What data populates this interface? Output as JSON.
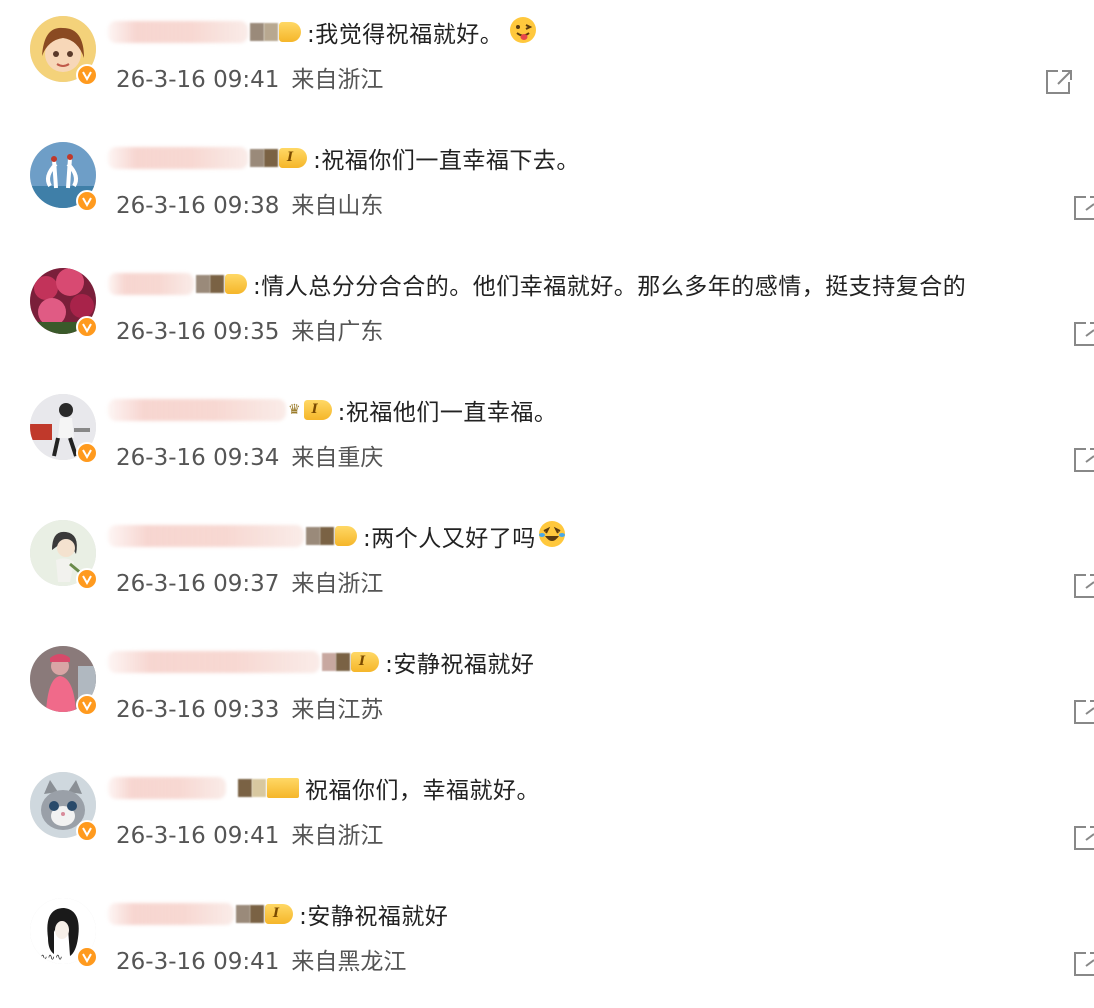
{
  "comments": [
    {
      "text": ":我觉得祝福就好。",
      "emoji": "tongue-out-face-emoji",
      "time": "26-3-16 09:41",
      "location": "来自浙江",
      "avatar": "cartoon-girl-avatar",
      "badge": "level-pill-noI",
      "colors": {
        "avatar_bg": "#f4d27a"
      }
    },
    {
      "text": ":祝福你们一直幸福下去。",
      "time": "26-3-16 09:38",
      "location": "来自山东",
      "avatar": "cranes-avatar",
      "badge": "level-pill-I"
    },
    {
      "text": ":情人总分分合合的。他们幸福就好。那么多年的感情，挺支持复合的",
      "time": "26-3-16 09:35",
      "location": "来自广东",
      "avatar": "flowers-avatar",
      "badge": "level-pill-noI"
    },
    {
      "text": ":祝福他们一直幸福。",
      "time": "26-3-16 09:34",
      "location": "来自重庆",
      "avatar": "woman-chair-avatar",
      "badge": "level-pill-I-crown"
    },
    {
      "text": ":两个人又好了吗",
      "emoji": "laughing-tears-emoji",
      "time": "26-3-16 09:37",
      "location": "来自浙江",
      "avatar": "illustration-girl-avatar",
      "badge": "level-pill-noI"
    },
    {
      "text": ":安静祝福就好",
      "time": "26-3-16 09:33",
      "location": "来自江苏",
      "avatar": "person-pink-avatar",
      "badge": "level-pill-I"
    },
    {
      "text": "祝福你们，幸福就好。",
      "time": "26-3-16 09:41",
      "location": "来自浙江",
      "avatar": "cat-avatar",
      "badge": "level-blocks"
    },
    {
      "text": ":安静祝福就好",
      "time": "26-3-16 09:41",
      "location": "来自黑龙江",
      "avatar": "sketch-girl-avatar",
      "badge": "level-pill-I"
    }
  ],
  "badge_text": "I",
  "colors": {
    "verified_badge": "#ff9a1e",
    "level_pill": "#f5b62a",
    "meta_text": "#555555"
  }
}
